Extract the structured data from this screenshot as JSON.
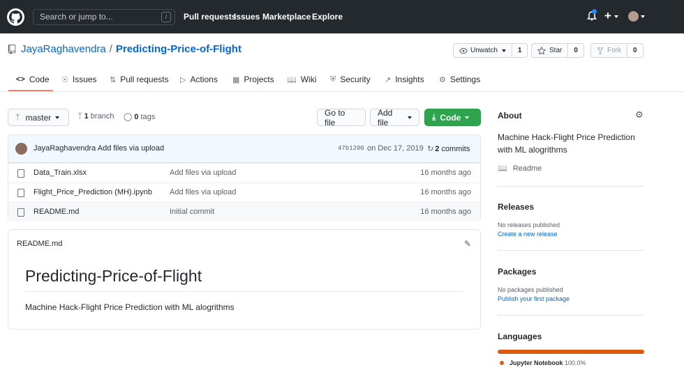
{
  "header": {
    "search_placeholder": "Search or jump to...",
    "search_shortcut": "/",
    "nav": [
      "Pull requests",
      "Issues",
      "Marketplace",
      "Explore"
    ],
    "plus": "+"
  },
  "repo": {
    "owner": "JayaRaghavendra",
    "separator": "/",
    "name": "Predicting-Price-of-Flight",
    "unwatch_label": "Unwatch",
    "unwatch_count": "1",
    "star_label": "Star",
    "star_count": "0",
    "fork_label": "Fork",
    "fork_count": "0"
  },
  "tabs": [
    "Code",
    "Issues",
    "Pull requests",
    "Actions",
    "Projects",
    "Wiki",
    "Security",
    "Insights",
    "Settings"
  ],
  "toolbar": {
    "branch": "master",
    "branches_count": "1",
    "branches_label": "branch",
    "tags_count": "0",
    "tags_label": "tags",
    "go_to_file": "Go to file",
    "add_file": "Add file",
    "code": "Code"
  },
  "commit": {
    "author": "JayaRaghavendra",
    "message": "Add files via upload",
    "sha": "47b1200",
    "date": "on Dec 17, 2019",
    "commits_count": "2",
    "commits_label": "commits"
  },
  "files": [
    {
      "name": "Data_Train.xlsx",
      "message": "Add files via upload",
      "time": "16 months ago"
    },
    {
      "name": "Flight_Price_Prediction (MH).ipynb",
      "message": "Add files via upload",
      "time": "16 months ago"
    },
    {
      "name": "README.md",
      "message": "Initial commit",
      "time": "16 months ago"
    }
  ],
  "readme": {
    "filename": "README.md",
    "heading": "Predicting-Price-of-Flight",
    "body": "Machine Hack-Flight Price Prediction with ML alogrithms"
  },
  "about": {
    "title": "About",
    "description": "Machine Hack-Flight Price Prediction with ML alogrithms",
    "readme_link": "Readme"
  },
  "releases": {
    "title": "Releases",
    "text": "No releases published",
    "link": "Create a new release"
  },
  "packages": {
    "title": "Packages",
    "text": "No packages published",
    "link": "Publish your first package"
  },
  "languages": {
    "title": "Languages",
    "items": [
      {
        "name": "Jupyter Notebook",
        "percent": "100.0%",
        "color": "#DA5B0B"
      }
    ]
  },
  "colors": {
    "accent": "#0366d6",
    "header_bg": "#24292e",
    "green": "#2ea44f",
    "tab_underline": "#f9826c"
  }
}
